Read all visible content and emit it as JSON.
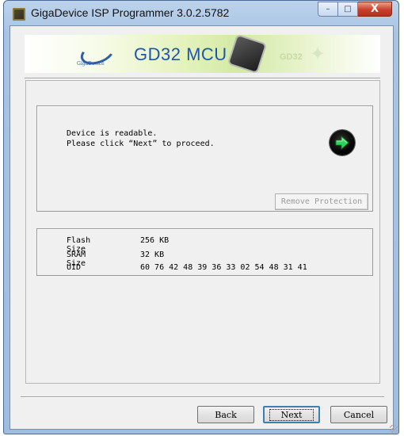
{
  "window": {
    "title": "GigaDevice ISP Programmer 3.0.2.5782",
    "min_label": "–",
    "max_label": "□",
    "close_label": "X"
  },
  "banner": {
    "company": "GigaDevice",
    "product": "GD32 MCU",
    "chip_brand": "GD32"
  },
  "status": {
    "line1": "Device is readable.",
    "line2": "Please click “Next” to proceed.",
    "icon": "green-arrow-icon",
    "remove_protection_label": "Remove Protection"
  },
  "device_info": {
    "rows": [
      {
        "label": "Flash Size",
        "value": "256 KB"
      },
      {
        "label": "SRAM Size",
        "value": "32 KB"
      },
      {
        "label": "UID",
        "value": "60 76 42 48 39 36 33 02 54 48 31 41"
      }
    ]
  },
  "buttons": {
    "back": "Back",
    "next": "Next",
    "cancel": "Cancel"
  },
  "colors": {
    "accent": "#1e57a8",
    "go_arrow": "#2fd35a",
    "close_button": "#c8402a"
  }
}
